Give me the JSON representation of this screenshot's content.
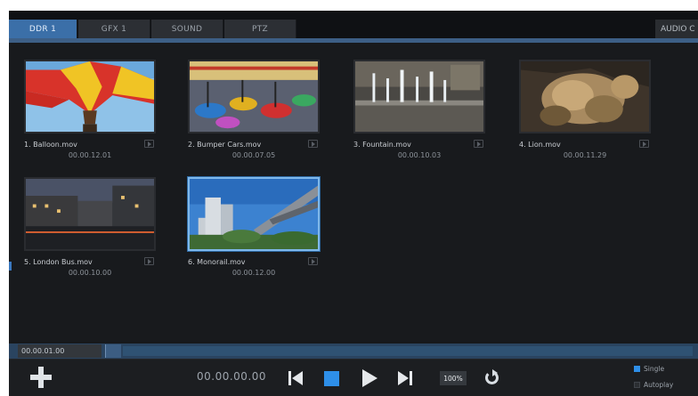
{
  "tabs": [
    {
      "label": "DDR 1",
      "active": true
    },
    {
      "label": "GFX 1",
      "active": false
    },
    {
      "label": "SOUND",
      "active": false
    },
    {
      "label": "PTZ",
      "active": false
    }
  ],
  "audio_tab": {
    "label": "AUDIO C"
  },
  "clips": [
    {
      "name": "1. Balloon.mov",
      "duration": "00.00.12.01",
      "selected": false
    },
    {
      "name": "2. Bumper Cars.mov",
      "duration": "00.00.07.05",
      "selected": false
    },
    {
      "name": "3. Fountain.mov",
      "duration": "00.00.10.03",
      "selected": false
    },
    {
      "name": "4. Lion.mov",
      "duration": "00.00.11.29",
      "selected": false
    },
    {
      "name": "5. London Bus.mov",
      "duration": "00.00.10.00",
      "selected": false
    },
    {
      "name": "6. Monorail.mov",
      "duration": "00.00.12.00",
      "selected": true
    }
  ],
  "timeline": {
    "timecode": "00.00.01.00"
  },
  "transport": {
    "time": "00.00.00.00",
    "speed": "100%",
    "modes": [
      {
        "label": "Single",
        "checked": true
      },
      {
        "label": "Autoplay",
        "checked": false
      }
    ]
  },
  "icons": {
    "add": "plus-icon",
    "previous": "skip-previous-icon",
    "stop": "stop-icon",
    "play": "play-icon",
    "next": "skip-next-icon",
    "loop": "loop-icon"
  },
  "colors": {
    "accent": "#2e8fe8",
    "active_tab": "#3b6fa8",
    "background": "#17191c"
  }
}
